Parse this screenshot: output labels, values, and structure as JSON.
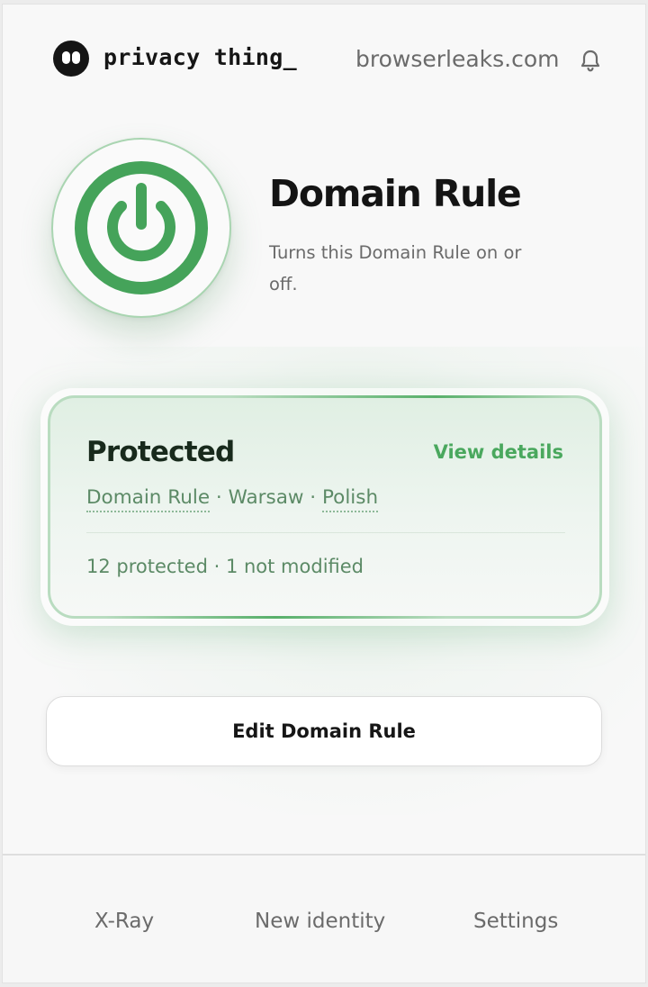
{
  "header": {
    "brand": "privacy thing_",
    "domain": "browserleaks.com"
  },
  "rule": {
    "title": "Domain Rule",
    "description": "Turns this Domain Rule on or off."
  },
  "status_card": {
    "title": "Protected",
    "view_details_label": "View details",
    "meta": {
      "rule_link": "Domain Rule",
      "separator": "·",
      "city": "Warsaw",
      "language_link": "Polish"
    },
    "stats": "12 protected · 1 not modified"
  },
  "edit_button_label": "Edit Domain Rule",
  "footer": {
    "items": [
      {
        "label": "X-Ray"
      },
      {
        "label": "New identity"
      },
      {
        "label": "Settings"
      }
    ]
  },
  "icons": {
    "logo": "eyes-logo-icon",
    "notifications": "bell-icon",
    "power": "power-icon"
  },
  "colors": {
    "accent_green": "#4aa85e",
    "power_green": "#45a35a",
    "card_border": "#b9dcc0",
    "muted_text": "#6b6b6b"
  }
}
